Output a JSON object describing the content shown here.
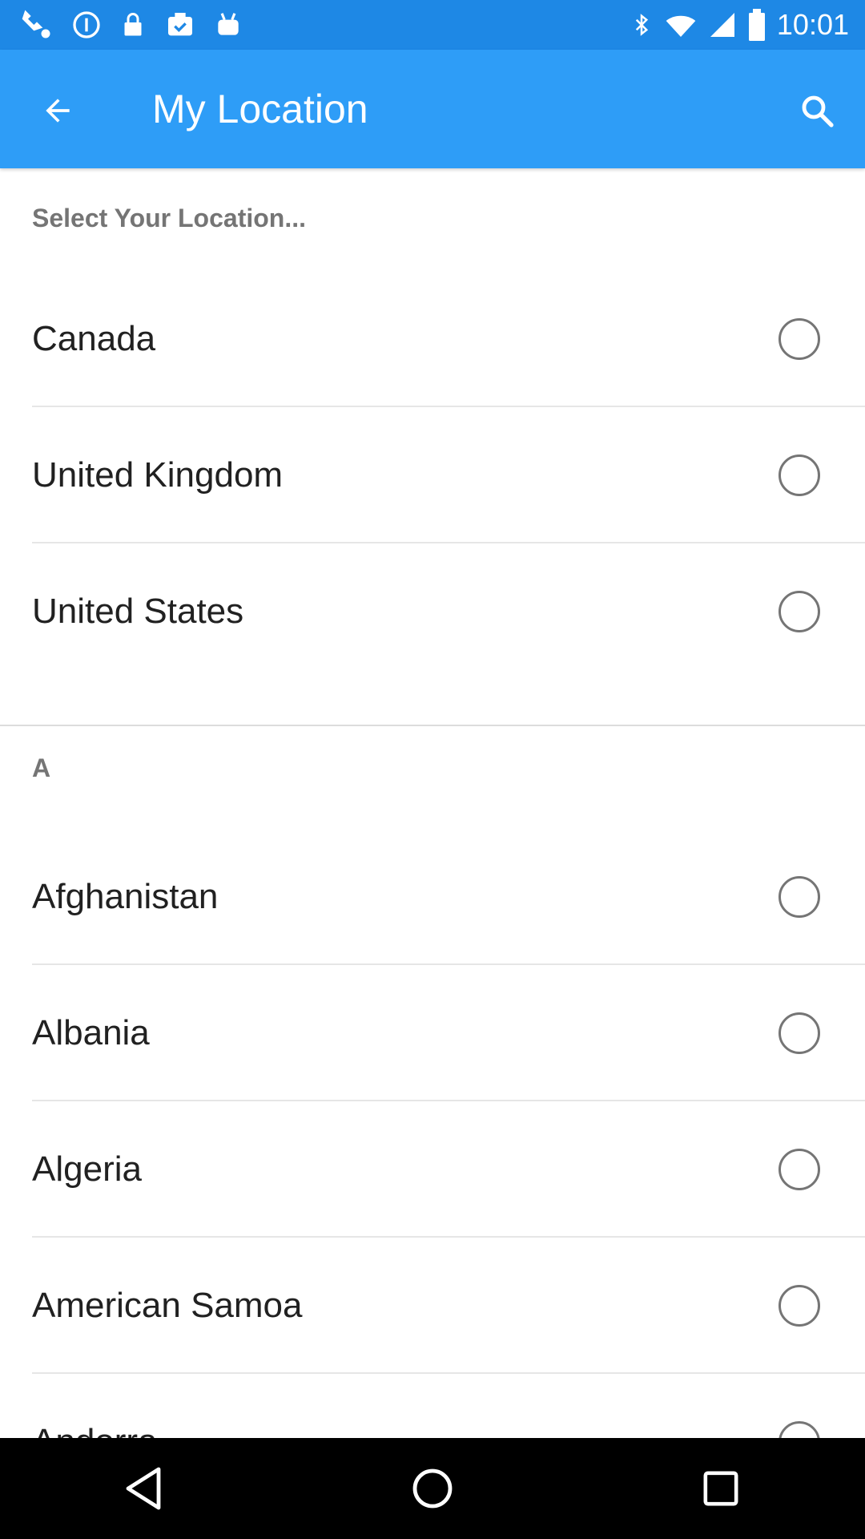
{
  "status_bar": {
    "time": "10:01",
    "left_icons": [
      "fake-gps-icon",
      "sync-icon",
      "lock-icon",
      "task-icon",
      "android-icon"
    ],
    "right_icons": [
      "bluetooth-icon",
      "wifi-icon",
      "signal-icon",
      "battery-icon"
    ]
  },
  "app_bar": {
    "title": "My Location",
    "back_icon": "arrow-back-icon",
    "search_icon": "search-icon",
    "background": "#2E9DF7"
  },
  "top_section": {
    "header": "Select Your Location...",
    "items": [
      {
        "label": "Canada"
      },
      {
        "label": "United Kingdom"
      },
      {
        "label": "United States"
      }
    ]
  },
  "alpha_section": {
    "letter": "A",
    "items": [
      {
        "label": "Afghanistan"
      },
      {
        "label": "Albania"
      },
      {
        "label": "Algeria"
      },
      {
        "label": "American Samoa"
      },
      {
        "label": "Andorra"
      }
    ]
  },
  "nav_bar": {
    "buttons": [
      "back-triangle-icon",
      "home-circle-icon",
      "recents-square-icon"
    ]
  }
}
